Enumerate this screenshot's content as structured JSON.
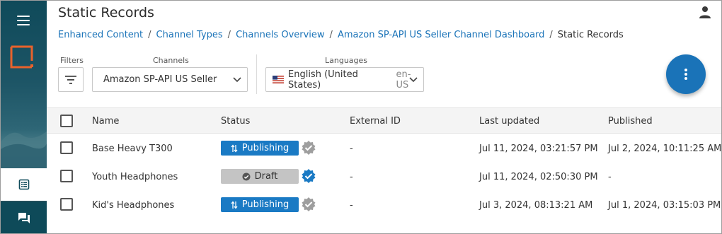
{
  "page": {
    "title": "Static Records"
  },
  "breadcrumb": {
    "items": [
      "Enhanced Content",
      "Channel Types",
      "Channels Overview",
      "Amazon SP-API US Seller Channel Dashboard"
    ],
    "current": "Static Records",
    "separator": "/"
  },
  "filters": {
    "filters_label": "Filters",
    "channels_label": "Channels",
    "channels_value": "Amazon SP-API US Seller",
    "languages_label": "Languages",
    "language_value": "English (United States)",
    "language_code": "en-US"
  },
  "table": {
    "columns": [
      "Name",
      "Status",
      "External ID",
      "Last updated",
      "Published"
    ],
    "rows": [
      {
        "name": "Base Heavy T300",
        "status": "Publishing",
        "status_kind": "publishing",
        "verified": "grey",
        "external_id": "-",
        "last_updated": "Jul 11, 2024, 03:21:57 PM",
        "published": "Jul 2, 2024, 10:11:25 AM"
      },
      {
        "name": "Youth Headphones",
        "status": "Draft",
        "status_kind": "draft",
        "verified": "blue",
        "external_id": "-",
        "last_updated": "Jul 11, 2024, 02:50:30 PM",
        "published": "-"
      },
      {
        "name": "Kid's Headphones",
        "status": "Publishing",
        "status_kind": "publishing",
        "verified": "grey",
        "external_id": "-",
        "last_updated": "Jul 3, 2024, 08:13:21 AM",
        "published": "Jul 1, 2024, 03:15:03 PM"
      }
    ]
  },
  "icons": {
    "menu": "hamburger-icon",
    "logo": "brand-logo-icon",
    "records": "list-icon",
    "chat": "chat-icon",
    "user": "account-icon",
    "filter": "filter-icon",
    "more": "more-vertical-icon",
    "flag": "us-flag-icon"
  },
  "colors": {
    "accent": "#1a73b8",
    "publishing": "#1a7ac4",
    "draft": "#c4c4c4",
    "verified_blue": "#1a7ac4",
    "verified_grey": "#9e9e9e",
    "logo": "#e8622c"
  }
}
